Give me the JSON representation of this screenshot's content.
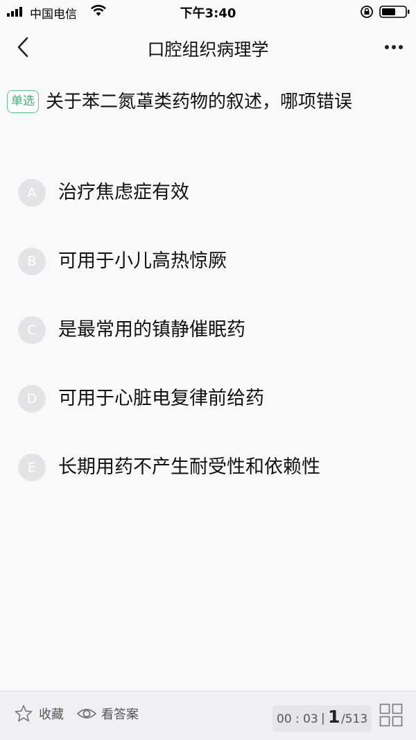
{
  "status_bar": {
    "carrier": "中国电信",
    "time": "下午3:40"
  },
  "nav": {
    "title": "口腔组织病理学"
  },
  "question": {
    "type_badge": "单选",
    "text": "关于苯二氮䓬类药物的叙述，哪项错误"
  },
  "options": [
    {
      "letter": "A",
      "text": "治疗焦虑症有效"
    },
    {
      "letter": "B",
      "text": "可用于小儿高热惊厥"
    },
    {
      "letter": "C",
      "text": "是最常用的镇静催眠药"
    },
    {
      "letter": "D",
      "text": "可用于心脏电复律前给药"
    },
    {
      "letter": "E",
      "text": "长期用药不产生耐受性和依赖性"
    }
  ],
  "bottom_bar": {
    "favorite_label": "收藏",
    "view_answer_label": "看答案",
    "timer": "00 : 03",
    "separator": "|",
    "current_question": "1",
    "total_questions": "/513"
  },
  "colors": {
    "accent_green": "#3fae74",
    "option_circle": "#e4e4e6",
    "background": "#faf9fa"
  }
}
